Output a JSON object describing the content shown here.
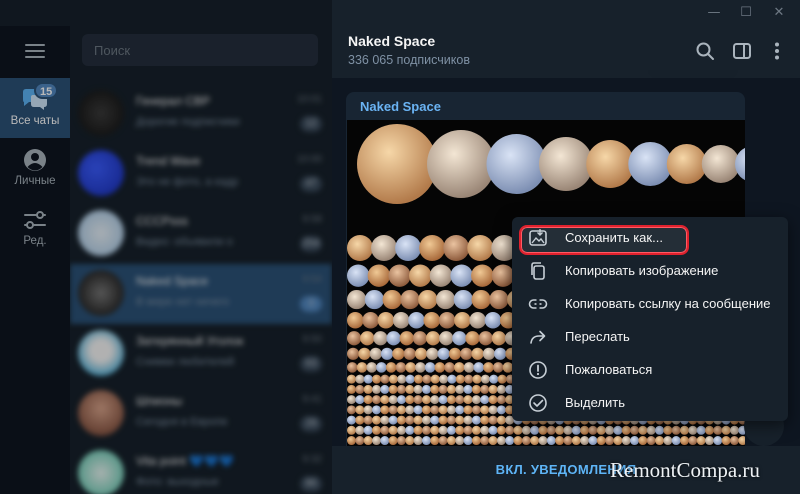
{
  "window": {
    "minimize_glyph": "—",
    "maximize_glyph": "☐",
    "close_glyph": "✕"
  },
  "rail": {
    "items": [
      {
        "label": "Все чаты",
        "icon": "chats-icon",
        "badge": "15",
        "active": true
      },
      {
        "label": "Личные",
        "icon": "person-icon"
      },
      {
        "label": "Ред.",
        "icon": "filter-edit-icon"
      }
    ]
  },
  "search": {
    "placeholder": "Поиск"
  },
  "chats": [
    {
      "title": "Генерал СВР",
      "snippet": "Дорогие подписчики",
      "time": "10:01",
      "count": "12"
    },
    {
      "title": "Trend Wave",
      "snippet": "Это не фото, а кадр",
      "time": "10:00",
      "count": "47"
    },
    {
      "title": "СССРsss",
      "snippet": "Видео: объявили о",
      "time": "9:58",
      "count": "254"
    },
    {
      "title": "Naked Space",
      "snippet": "В мире нет ничего",
      "time": "9:54",
      "count": "3"
    },
    {
      "title": "Затерянный Уголок",
      "snippet": "Снимки любителей",
      "time": "9:50",
      "count": "63"
    },
    {
      "title": "Шпионы",
      "snippet": "Сегодня в Европе",
      "time": "9:41",
      "count": "29"
    },
    {
      "title": "Vita point 💙💙💙",
      "snippet": "Фото: выходные",
      "time": "9:32",
      "count": "86"
    }
  ],
  "channel": {
    "title": "Naked Space",
    "subscribers": "336 065 подписчиков"
  },
  "header_icons": [
    "search-icon",
    "sidebar-toggle-icon",
    "more-vertical-icon"
  ],
  "message": {
    "author": "Naked Space"
  },
  "footer": {
    "button_label": "ВКЛ. УВЕДОМЛЕНИЯ"
  },
  "context_menu": {
    "items": [
      {
        "label": "Сохранить как...",
        "icon": "save-image-icon",
        "highlighted": true
      },
      {
        "label": "Копировать изображение",
        "icon": "copy-icon"
      },
      {
        "label": "Копировать ссылку на сообщение",
        "icon": "link-icon"
      },
      {
        "label": "Переслать",
        "icon": "forward-icon"
      },
      {
        "label": "Пожаловаться",
        "icon": "report-icon"
      },
      {
        "label": "Выделить",
        "icon": "select-check-icon"
      }
    ]
  },
  "watermark": "RemontCompa.ru",
  "colors": {
    "accent": "#5288c1",
    "link": "#5eb5f7",
    "author": "#6ab3f3",
    "highlight_border": "#e0212d"
  }
}
